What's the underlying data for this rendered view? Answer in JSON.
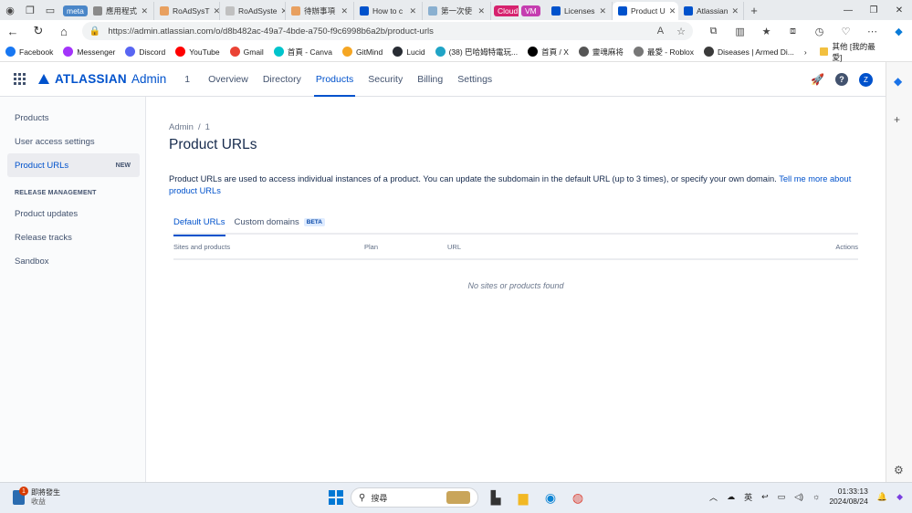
{
  "browser": {
    "tabs": [
      {
        "label": "meta",
        "pill": true,
        "color": "#4a86c8"
      },
      {
        "label": "應用程式",
        "color": "#8a8a8a"
      },
      {
        "label": "RoAdSysT",
        "color": "#e8a060"
      },
      {
        "label": "RoAdSyste",
        "color": "#c0c0c0"
      },
      {
        "label": "待辦事項",
        "color": "#e8a060"
      },
      {
        "label": "How to c",
        "color": "#0052cc"
      },
      {
        "label": "第一次使",
        "color": "#8ab0d0"
      },
      {
        "label": "Cloud",
        "pill": true,
        "color": "#d6226e"
      },
      {
        "label": "VM",
        "pill": true,
        "color": "#c53db0"
      },
      {
        "label": "Licenses",
        "color": "#0052cc"
      },
      {
        "label": "Product U",
        "color": "#0052cc",
        "active": true
      },
      {
        "label": "Atlassian",
        "color": "#0052cc"
      }
    ],
    "url": "https://admin.atlassian.com/o/d8b482ac-49a7-4bde-a750-f9c6998b6a2b/product-urls"
  },
  "bookmarks": [
    {
      "label": "Facebook",
      "color": "#1877f2"
    },
    {
      "label": "Messenger",
      "color": "#a334fa"
    },
    {
      "label": "Discord",
      "color": "#5865f2"
    },
    {
      "label": "YouTube",
      "color": "#ff0000"
    },
    {
      "label": "Gmail",
      "color": "#ea4335"
    },
    {
      "label": "首頁 - Canva",
      "color": "#00c4cc"
    },
    {
      "label": "GitMind",
      "color": "#f5a623"
    },
    {
      "label": "Lucid",
      "color": "#282c33"
    },
    {
      "label": "(38) 巴哈姆特電玩...",
      "color": "#20a4c6"
    },
    {
      "label": "首頁 / X",
      "color": "#000000"
    },
    {
      "label": "靈魂麻将",
      "color": "#555555"
    },
    {
      "label": "最愛 - Roblox",
      "color": "#777777"
    },
    {
      "label": "Diseases | Armed Di...",
      "color": "#3a3a3a"
    }
  ],
  "bookmarks_other": "其他 [我的最愛]",
  "app": {
    "brand": "ATLASSIAN",
    "product": "Admin",
    "org": "1",
    "nav": [
      {
        "label": "Overview"
      },
      {
        "label": "Directory"
      },
      {
        "label": "Products",
        "active": true
      },
      {
        "label": "Security"
      },
      {
        "label": "Billing"
      },
      {
        "label": "Settings"
      }
    ],
    "avatar_initial": "Z"
  },
  "sidebar": {
    "items": [
      {
        "label": "Products"
      },
      {
        "label": "User access settings"
      },
      {
        "label": "Product URLs",
        "badge": "NEW",
        "active": true
      }
    ],
    "section_title": "RELEASE MANAGEMENT",
    "section_items": [
      {
        "label": "Product updates"
      },
      {
        "label": "Release tracks"
      },
      {
        "label": "Sandbox"
      }
    ]
  },
  "main": {
    "breadcrumb": [
      "Admin",
      "1"
    ],
    "title": "Product URLs",
    "description": "Product URLs are used to access individual instances of a product. You can update the subdomain in the default URL (up to 3 times), or specify your own domain.",
    "link": "Tell me more about product URLs",
    "tabs": [
      {
        "label": "Default URLs",
        "active": true
      },
      {
        "label": "Custom domains",
        "badge": "BETA"
      }
    ],
    "table": {
      "columns": [
        "Sites and products",
        "Plan",
        "URL",
        "Actions"
      ],
      "empty": "No sites or products found"
    }
  },
  "taskbar": {
    "news_count": "1",
    "news_title": "即將發生",
    "news_sub": "收益",
    "search_placeholder": "搜尋",
    "ime": "英",
    "time": "01:33:13",
    "date": "2024/08/24"
  }
}
